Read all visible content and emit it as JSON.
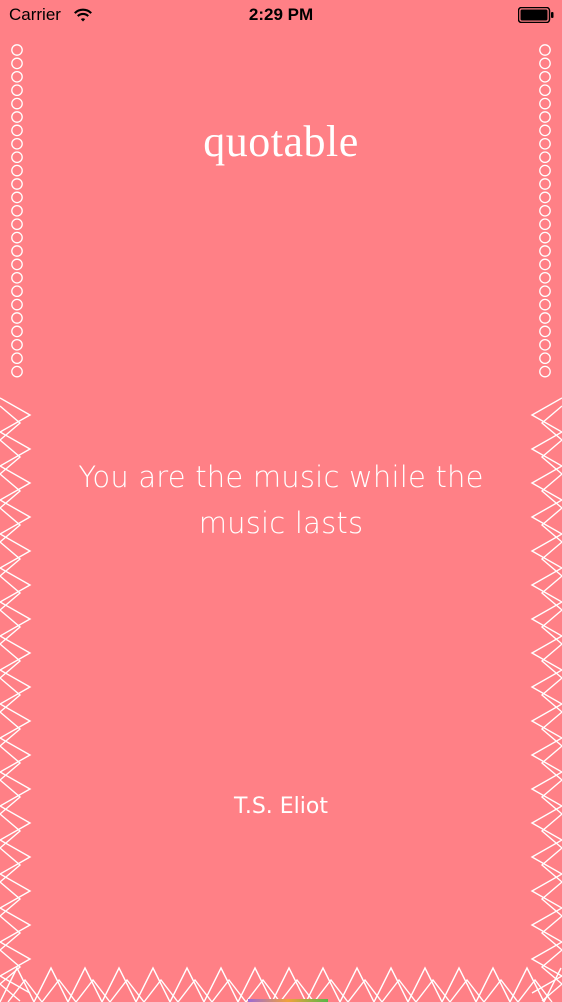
{
  "status_bar": {
    "carrier": "Carrier",
    "time": "2:29 PM",
    "wifi_icon": "wifi-icon",
    "battery_icon": "battery-icon"
  },
  "app": {
    "title": "quotable"
  },
  "quote": {
    "text": "You are the music while the music lasts",
    "author": "T.S. Eliot"
  },
  "colors": {
    "background": "#ff8086",
    "text": "#ffffff",
    "decor": "#ffffff"
  },
  "decor": {
    "left_border_icon": "circle-chain-icon",
    "zigzag_border_icon": "zigzag-border-icon"
  }
}
